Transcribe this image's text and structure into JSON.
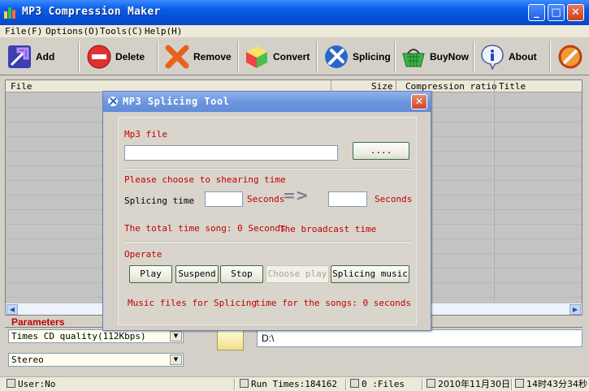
{
  "window": {
    "title": "MP3 Compression Maker"
  },
  "menu": [
    {
      "label": "File(F)"
    },
    {
      "label": "Options(O)"
    },
    {
      "label": "Tools(C)"
    },
    {
      "label": "Help(H)"
    }
  ],
  "toolbar": [
    {
      "label": "Add",
      "icon": "add-arrow-icon"
    },
    {
      "label": "Delete",
      "icon": "delete-icon"
    },
    {
      "label": "Remove",
      "icon": "remove-x-icon"
    },
    {
      "label": "Convert",
      "icon": "convert-cube-icon"
    },
    {
      "label": "Splicing",
      "icon": "splicing-tool-icon"
    },
    {
      "label": "BuyNow",
      "icon": "shopping-basket-icon"
    },
    {
      "label": "About",
      "icon": "info-icon"
    },
    {
      "label": "",
      "icon": "exit-icon"
    }
  ],
  "list": {
    "columns": [
      {
        "label": "File"
      },
      {
        "label": "Size"
      },
      {
        "label": "Compression ratio"
      },
      {
        "label": "Title"
      }
    ]
  },
  "parameters": {
    "title": "Parameters",
    "quality": "Times CD quality(112Kbps)",
    "channel": "Stereo",
    "output_path": "D:\\"
  },
  "status": {
    "user": "User:No",
    "run_times": "Run Times:184162",
    "files": "0 :Files",
    "date": "2010年11月30日",
    "time": "14时43分34秒"
  },
  "dialog": {
    "title": "MP3 Splicing Tool",
    "mp3_file_label": "Mp3 file",
    "mp3_file_value": "",
    "browse_label": "....",
    "choose_time_label": "Please choose to shearing time",
    "splicing_time_label": "Splicing time",
    "start_value": "",
    "seconds_1": "Seconds",
    "arrow": "=>",
    "end_value": "",
    "seconds_2": "Seconds",
    "total_time": "The total time song: 0 Seconds",
    "broadcast_time": "The broadcast time",
    "operate_label": "Operate",
    "buttons": [
      {
        "label": "Play",
        "enabled": true
      },
      {
        "label": "Suspend",
        "enabled": true
      },
      {
        "label": "Stop",
        "enabled": true
      },
      {
        "label": "Choose play",
        "enabled": false
      },
      {
        "label": "Splicing music",
        "enabled": true
      }
    ],
    "music_files": "Music files for Splicing",
    "songs_time": "time for the songs: 0 seconds"
  },
  "colors": {
    "titlebar": "#0a5ee8",
    "accent_red": "#c00000",
    "dialog_title": "#6e96e0"
  }
}
